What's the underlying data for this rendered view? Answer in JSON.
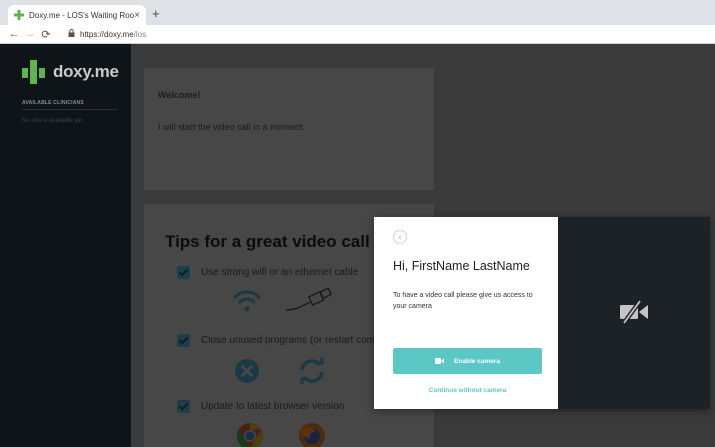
{
  "browser": {
    "tab_title": "Doxy.me - LOS's Waiting Room",
    "tab_close": "×",
    "new_tab": "+",
    "url_host": "https://doxy.me",
    "url_path": "/los"
  },
  "sidebar": {
    "logo_text": "doxy.me",
    "available_label": "AVAILABLE CLINICIANS",
    "no_clinicians": "No one is available yet"
  },
  "welcome": {
    "title": "Welcome!",
    "message": "I will start the video call in a moment."
  },
  "tips": {
    "title": "Tips for a great video call",
    "items": [
      {
        "label": "Use strong wifi or an ethernet cable"
      },
      {
        "label": "Close unused programs (or restart computer)"
      },
      {
        "label": "Update to latest browser version"
      }
    ]
  },
  "modal": {
    "back_glyph": "‹",
    "title": "Hi, FirstName LastName",
    "description": "To have a video call please give us access to your camera",
    "enable_label": "Enable camera",
    "continue_label": "Continue without camera"
  },
  "colors": {
    "accent": "#5bc8c6",
    "brand_green": "#5fb44f",
    "sidebar_bg": "#0f1418",
    "modal_dark": "#1d2226"
  }
}
